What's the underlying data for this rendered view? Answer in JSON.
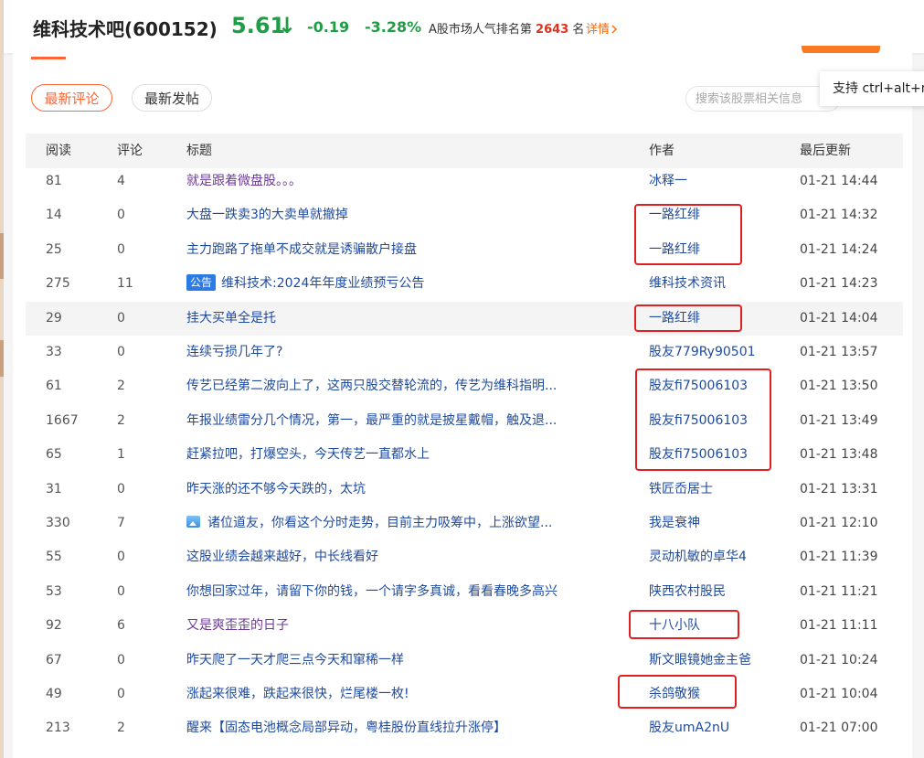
{
  "header": {
    "stock_name": "维科技术吧(600152)",
    "price": "5.61",
    "arrow": "↓",
    "change": "-0.19",
    "change_pct": "-3.28%",
    "rank_prefix": "A股市场人气排名第",
    "rank_num": "2643",
    "rank_suffix": "名",
    "detail_label": "详情",
    "detail_icon": "chevron-right-icon",
    "price_color": "#1e9e44",
    "accent_color": "#ff6633"
  },
  "tabs": [
    {
      "label": "最新评论",
      "active": true
    },
    {
      "label": "最新发帖",
      "active": false
    }
  ],
  "search": {
    "placeholder": "搜索该股票相关信息"
  },
  "tooltip": {
    "text": "支持 ctrl+alt+n"
  },
  "table": {
    "headers": {
      "read": "阅读",
      "comments": "评论",
      "title": "标题",
      "author": "作者",
      "updated": "最后更新"
    },
    "rows": [
      {
        "read": "81",
        "comments": "4",
        "title": "就是跟着微盘股。。。",
        "author": "冰释一",
        "time": "01-21 14:44",
        "visited": true
      },
      {
        "read": "14",
        "comments": "0",
        "title": "大盘一跌卖3的大卖单就撤掉",
        "author": "一路红绯",
        "time": "01-21 14:32"
      },
      {
        "read": "25",
        "comments": "0",
        "title": "主力跑路了拖单不成交就是诱骗散户接盘",
        "author": "一路红绯",
        "time": "01-21 14:24"
      },
      {
        "read": "275",
        "comments": "11",
        "badge": "公告",
        "title": "维科技术:2024年年度业绩预亏公告",
        "author": "维科技术资讯",
        "time": "01-21 14:23"
      },
      {
        "read": "29",
        "comments": "0",
        "title": "挂大买单全是托",
        "author": "一路红绯",
        "time": "01-21 14:04",
        "highlight": true
      },
      {
        "read": "33",
        "comments": "0",
        "title": "连续亏损几年了?",
        "author": "股友779Ry90501",
        "time": "01-21 13:57"
      },
      {
        "read": "61",
        "comments": "2",
        "title": "传艺已经第二波向上了，这两只股交替轮流的，传艺为维科指明...",
        "author": "股友fi75006103",
        "time": "01-21 13:50"
      },
      {
        "read": "1667",
        "comments": "2",
        "title": "年报业绩雷分几个情况，第一，最严重的就是披星戴帽，触及退...",
        "author": "股友fi75006103",
        "time": "01-21 13:49"
      },
      {
        "read": "65",
        "comments": "1",
        "title": "赶紧拉吧，打爆空头，今天传艺一直都水上",
        "author": "股友fi75006103",
        "time": "01-21 13:48"
      },
      {
        "read": "31",
        "comments": "0",
        "title": "昨天涨的还不够今天跌的，太坑",
        "author": "铁匠岙居士",
        "time": "01-21 13:31"
      },
      {
        "read": "330",
        "comments": "7",
        "image": true,
        "title": "诸位道友，你看这个分时走势，目前主力吸筹中，上涨欲望...",
        "author": "我是衰神",
        "time": "01-21 12:10"
      },
      {
        "read": "55",
        "comments": "0",
        "title": "这股业绩会越来越好，中长线看好",
        "author": "灵动机敏的卓华4",
        "time": "01-21 11:39"
      },
      {
        "read": "53",
        "comments": "0",
        "title": "你想回家过年，请留下你的钱，一个请字多真诚，看看春晚多高兴",
        "author": "陕西农村股民",
        "time": "01-21 11:21"
      },
      {
        "read": "92",
        "comments": "6",
        "title": "又是爽歪歪的日子",
        "author": "十八小队",
        "time": "01-21 11:11",
        "visited": true
      },
      {
        "read": "67",
        "comments": "0",
        "title": "昨天爬了一天才爬三点今天和窜稀一样",
        "author": "斯文眼镜她金主爸",
        "time": "01-21 10:24"
      },
      {
        "read": "49",
        "comments": "0",
        "title": "涨起来很难，跌起来很快，烂尾楼一枚!",
        "author": "杀鸽敬猴",
        "time": "01-21 10:04"
      },
      {
        "read": "213",
        "comments": "2",
        "title": "醒来【固态电池概念局部异动，粤桂股份直线拉升涨停】",
        "author": "股友umA2nU",
        "time": "01-21 07:00"
      }
    ]
  },
  "annotation_color": "#e02020"
}
